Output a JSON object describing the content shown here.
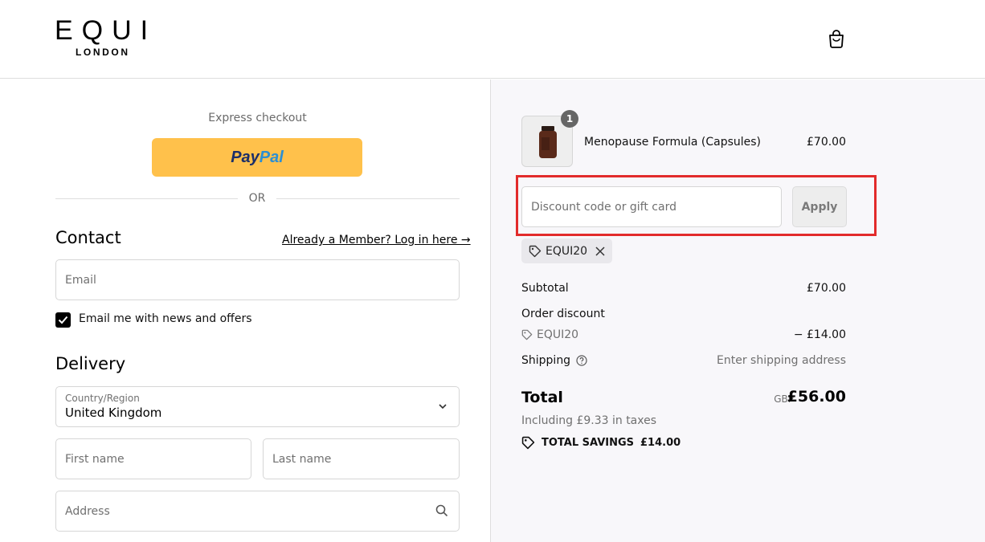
{
  "header": {
    "logo_main": "EQUI",
    "logo_sub": "LONDON",
    "cart_icon": "shopping-bag-icon"
  },
  "express": {
    "title": "Express checkout",
    "paypal_part1": "Pay",
    "paypal_part2": "Pal",
    "or_label": "OR"
  },
  "contact": {
    "heading": "Contact",
    "login_link": "Already a Member? Log in here →",
    "email_placeholder": "Email",
    "newsletter_label": "Email me with news and offers",
    "newsletter_checked": true
  },
  "delivery": {
    "heading": "Delivery",
    "country_label": "Country/Region",
    "country_value": "United Kingdom",
    "first_name_placeholder": "First name",
    "last_name_placeholder": "Last name",
    "address_placeholder": "Address"
  },
  "summary": {
    "product": {
      "name": "Menopause Formula (Capsules)",
      "price": "£70.00",
      "quantity": "1"
    },
    "discount_placeholder": "Discount code or gift card",
    "apply_label": "Apply",
    "applied_code": "EQUI20",
    "subtotal_label": "Subtotal",
    "subtotal_value": "£70.00",
    "order_discount_label": "Order discount",
    "discount_code": "EQUI20",
    "discount_value": "− £14.00",
    "shipping_label": "Shipping",
    "shipping_value": "Enter shipping address",
    "total_label": "Total",
    "total_currency": "GBP",
    "total_value": "£56.00",
    "taxes_note": "Including £9.33 in taxes",
    "savings_label": "TOTAL SAVINGS",
    "savings_value": "£14.00"
  },
  "colors": {
    "paypal_yellow": "#ffc14b",
    "highlight_red": "#e22b2b",
    "summary_bg": "#f8f7fa"
  }
}
